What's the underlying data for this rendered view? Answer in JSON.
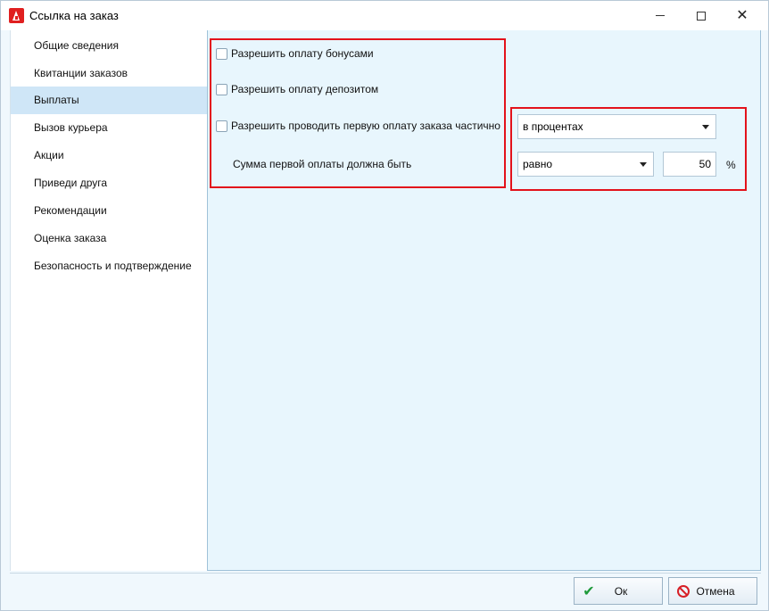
{
  "window": {
    "title": "Ссылка на заказ"
  },
  "sidebar": {
    "items": [
      {
        "label": "Общие сведения"
      },
      {
        "label": "Квитанции заказов"
      },
      {
        "label": "Выплаты"
      },
      {
        "label": "Вызов курьера"
      },
      {
        "label": "Акции"
      },
      {
        "label": "Приведи друга"
      },
      {
        "label": "Рекомендации"
      },
      {
        "label": "Оценка заказа"
      },
      {
        "label": "Безопасность и подтверждение"
      }
    ],
    "active_item": "Выплаты"
  },
  "payments": {
    "allow_bonus": {
      "label": "Разрешить оплату бонусами",
      "checked": false
    },
    "allow_deposit": {
      "label": "Разрешить оплату депозитом",
      "checked": false
    },
    "allow_partial": {
      "label": "Разрешить проводить первую оплату заказа частично",
      "checked": false
    },
    "first_payment_label": "Сумма первой оплаты должна быть",
    "unit_select": {
      "value": "в процентах"
    },
    "operator_select": {
      "value": "равно"
    },
    "amount": {
      "value": "50"
    },
    "unit_suffix": "%"
  },
  "footer": {
    "ok_label": "Ок",
    "cancel_label": "Отмена"
  },
  "colors": {
    "accent_red": "#e3121b",
    "active_nav": "#cfe6f7",
    "content_bg": "#e8f6fd",
    "ok_icon": "#1f9a3a"
  },
  "icons": {
    "app": "app-logo-icon",
    "minimize": "minimize-icon",
    "maximize": "maximize-icon",
    "close": "close-icon",
    "ok": "check-icon",
    "cancel": "cancel-icon"
  }
}
